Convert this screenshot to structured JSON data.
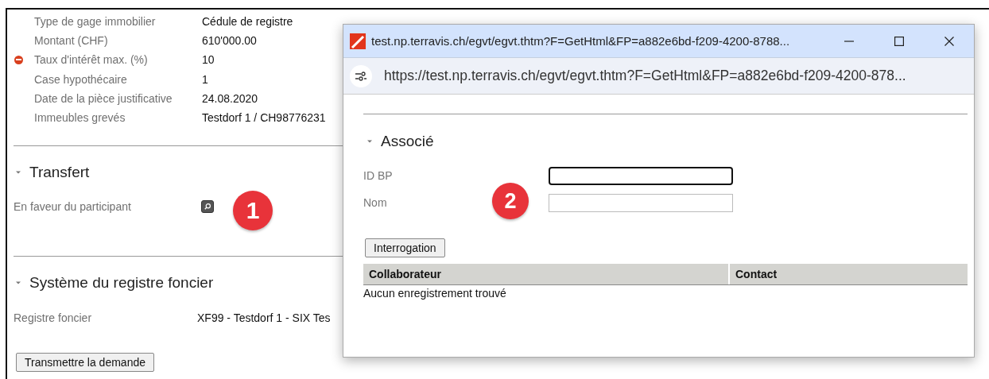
{
  "details": [
    {
      "label": "Type de gage immobilier",
      "value": "Cédule de registre",
      "error": false
    },
    {
      "label": "Montant (CHF)",
      "value": "610'000.00",
      "error": false
    },
    {
      "label": "Taux d'intérêt max. (%)",
      "value": "10",
      "error": true
    },
    {
      "label": "Case hypothécaire",
      "value": "1",
      "error": false
    },
    {
      "label": "Date de la pièce justificative",
      "value": "24.08.2020",
      "error": false
    },
    {
      "label": "Immeubles grevés",
      "value": "Testdorf 1 / CH98776231",
      "error": false
    }
  ],
  "transfer": {
    "title": "Transfert",
    "expanded": true,
    "field_label": "En faveur du participant",
    "callout": "1"
  },
  "land_register": {
    "title": "Système du registre foncier",
    "expanded": true,
    "field_label": "Registre foncier",
    "value": "XF99 - Testdorf 1 - SIX Tes"
  },
  "submit_button": "Transmettre la demande",
  "popup": {
    "title": "test.np.terravis.ch/egvt/egvt.thtm?F=GetHtml&FP=a882e6bd-f209-4200-8788...",
    "url": "https://test.np.terravis.ch/egvt/egvt.thtm?F=GetHtml&FP=a882e6bd-f209-4200-878...",
    "section": {
      "title": "Associé",
      "expanded": true
    },
    "fields": [
      {
        "label": "ID BP",
        "focused": true
      },
      {
        "label": "Nom",
        "focused": false
      }
    ],
    "callout": "2",
    "query_button": "Interrogation",
    "table": {
      "columns": [
        "Collaborateur",
        "Contact"
      ],
      "empty_text": "Aucun enregistrement trouvé"
    }
  }
}
